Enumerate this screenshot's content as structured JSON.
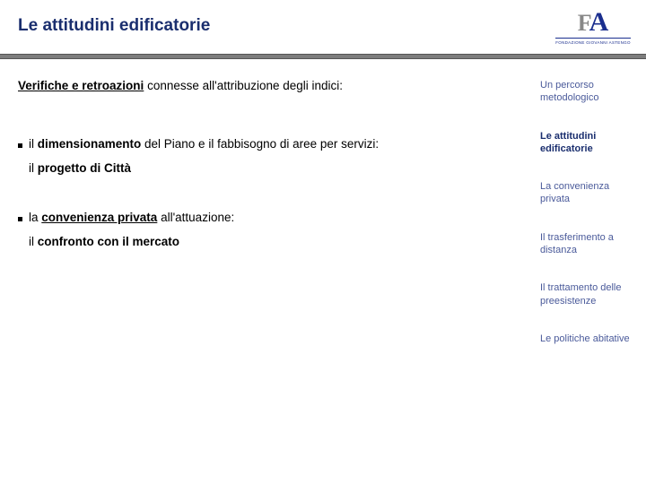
{
  "header": {
    "title": "Le attitudini edificatorie",
    "logo_f": "F",
    "logo_a": "A",
    "logo_sub": "FONDAZIONE GIOVANNI ASTENGO"
  },
  "main": {
    "lead_b": "Verifiche e retroazioni",
    "lead_rest": " connesse all'attribuzione degli indici:",
    "bullet1_pre": "il ",
    "bullet1_b": "dimensionamento",
    "bullet1_post": " del Piano e il fabbisogno di aree per servizi:",
    "sub1_pre": "il ",
    "sub1_b": "progetto di Città",
    "bullet2_pre": "la ",
    "bullet2_b": "convenienza privata",
    "bullet2_post": " all'attuazione:",
    "sub2_pre": "il ",
    "sub2_b": "confronto con il mercato"
  },
  "sidebar": {
    "items": [
      "Un percorso metodologico",
      "Le attitudini edificatorie",
      "La convenienza privata",
      "Il trasferimento a distanza",
      "Il trattamento delle preesistenze",
      "Le politiche abitative"
    ]
  }
}
